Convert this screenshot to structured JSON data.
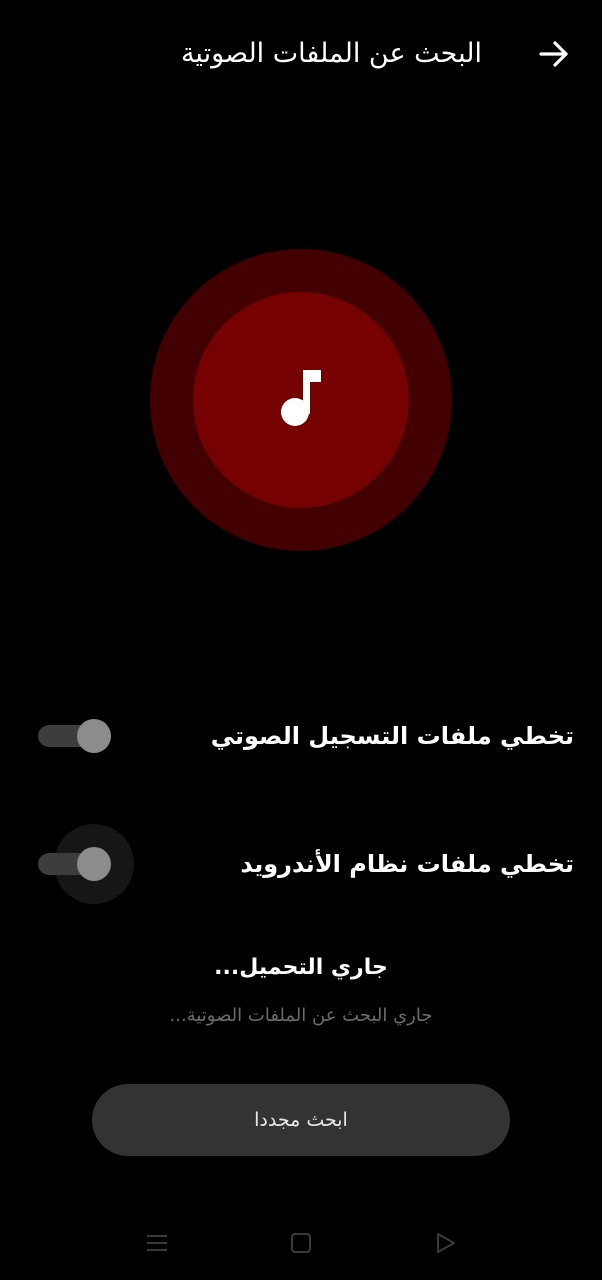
{
  "header": {
    "title": "البحث عن الملفات الصوتية",
    "back_icon": "arrow-right-icon"
  },
  "hero": {
    "icon": "music-note-icon",
    "outer_color": "#430000",
    "inner_color": "#750101"
  },
  "settings": {
    "items": [
      {
        "label": "تخطي ملفات التسجيل الصوتي",
        "enabled": true
      },
      {
        "label": "تخطي ملفات نظام الأندرويد",
        "enabled": true
      }
    ]
  },
  "status": {
    "title": "جاري التحميل...",
    "subtitle": "جاري البحث عن الملفات الصوتية..."
  },
  "actions": {
    "rescan_label": "ابحث مجددا"
  },
  "navbar": {
    "items": [
      "menu-icon",
      "home-square-icon",
      "back-triangle-icon"
    ]
  }
}
